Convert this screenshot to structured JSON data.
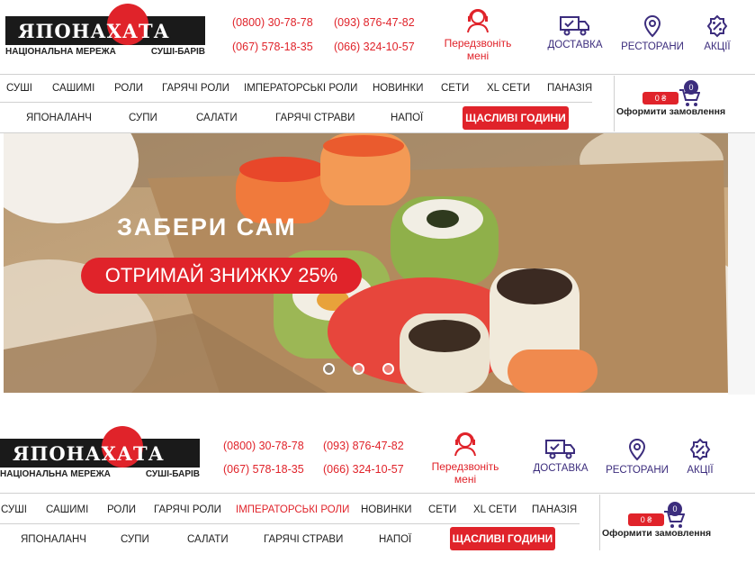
{
  "logo": {
    "text": "ЯПОНАХАТА",
    "sub_left": "НАЦІОНАЛЬНА МЕРЕЖА",
    "sub_right": "СУШІ-БАРІВ"
  },
  "phones": [
    "(0800) 30-78-78",
    "(093) 876-47-82",
    "(067) 578-18-35",
    "(066) 324-10-57"
  ],
  "callback": {
    "line1": "Передзвоніть",
    "line2": "мені"
  },
  "header_buttons": [
    "ДОСТАВКА",
    "РЕСТОРАНИ",
    "АКЦІЇ"
  ],
  "menu_row1": [
    "СУШІ",
    "САШИМІ",
    "РОЛИ",
    "ГАРЯЧІ РОЛИ",
    "ІМПЕРАТОРСЬКІ РОЛИ",
    "НОВИНКИ",
    "СЕТИ",
    "XL СЕТИ",
    "ПАНАЗІЯ"
  ],
  "menu_row2": [
    "ЯПОНАЛАНЧ",
    "СУПИ",
    "САЛАТИ",
    "ГАРЯЧІ СТРАВИ",
    "НАПОЇ"
  ],
  "happy_hours": "ЩАСЛИВІ ГОДИНИ",
  "cart": {
    "price": "0 ₴",
    "count": "0",
    "label": "Оформити замовлення"
  },
  "promo": {
    "headline": "ЗАБЕРИ САМ",
    "discount": "ОТРИМАЙ ЗНИЖКУ 25%"
  },
  "carousel": {
    "slides": 3,
    "active": 0
  },
  "colors": {
    "accent": "#e0232a",
    "brand": "#3c2d7d",
    "dark": "#1a1a1a"
  },
  "icons": {
    "callback": "operator-headset-icon",
    "delivery": "delivery-truck-icon",
    "restaurants": "map-pin-icon",
    "promos": "percent-badge-icon",
    "cart": "shopping-cart-icon"
  }
}
